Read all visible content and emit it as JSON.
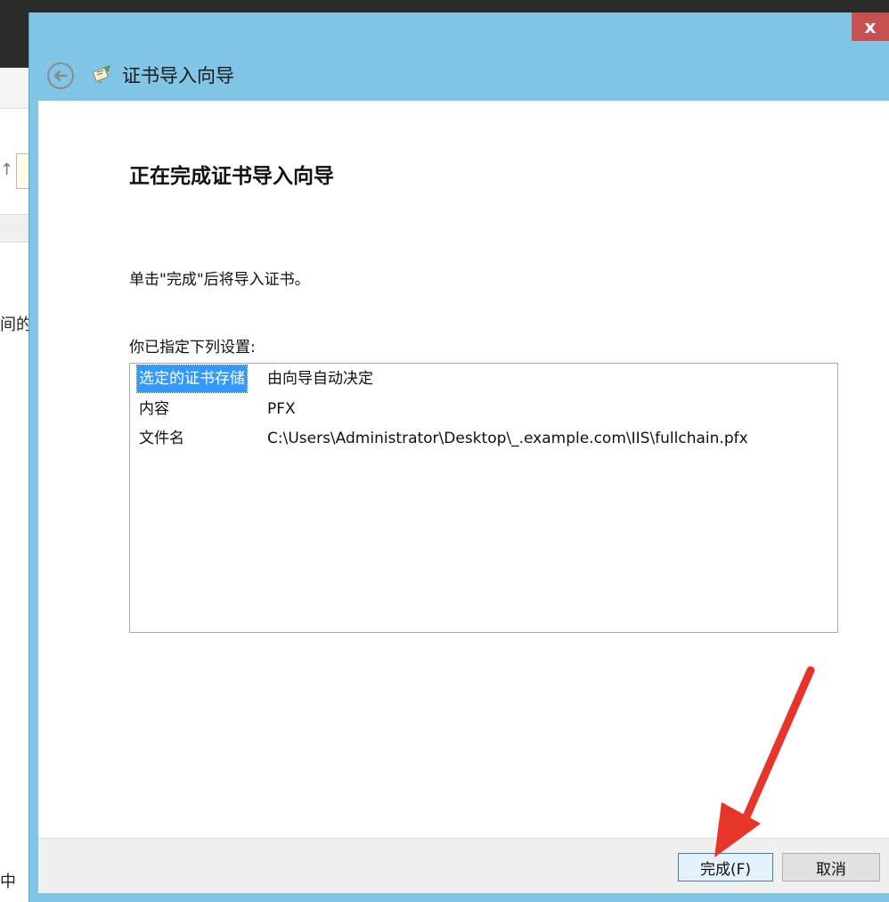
{
  "background": {
    "side_text_1": "间的",
    "side_text_2": "中"
  },
  "dialog": {
    "title": "证书导入向导",
    "close_label": "x",
    "heading": "正在完成证书导入向导",
    "instruction": "单击\"完成\"后将导入证书。",
    "settings_label": "你已指定下列设置:",
    "settings": [
      {
        "key": "选定的证书存储",
        "value": "由向导自动决定"
      },
      {
        "key": "内容",
        "value": "PFX"
      },
      {
        "key": "文件名",
        "value": "C:\\Users\\Administrator\\Desktop\\_.example.com\\IIS\\fullchain.pfx"
      }
    ],
    "buttons": {
      "finish": "完成(F)",
      "cancel": "取消"
    }
  },
  "colors": {
    "title_bar": "#80c6e4",
    "close": "#c75050",
    "selection": "#3399ff",
    "annotation_arrow": "#e8352a"
  },
  "icons": {
    "back": "back-arrow-circle-icon",
    "wizard": "certificate-wizard-icon",
    "annotation": "red-arrow-icon"
  }
}
